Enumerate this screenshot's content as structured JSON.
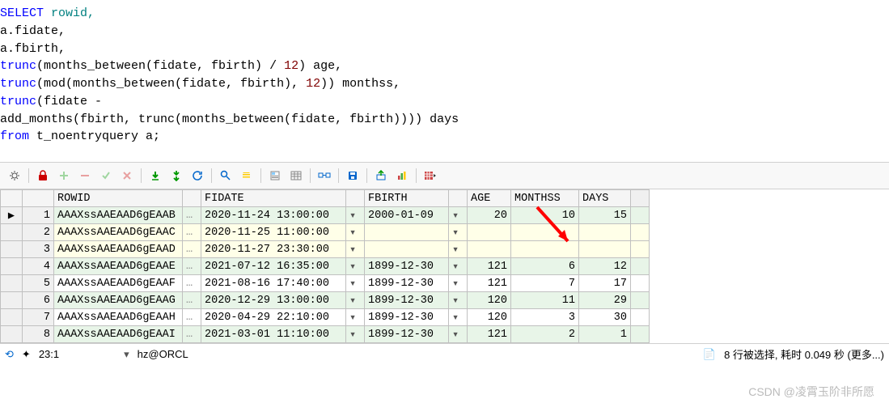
{
  "sql": {
    "line1_select": "SELECT",
    "line1_rowid": " rowid,",
    "line2": "       a.fidate,",
    "line3": "       a.fbirth,",
    "line4a": "       trunc",
    "line4b": "(months_between(fidate, fbirth) / ",
    "line4c": "12",
    "line4d": ") age,",
    "line5a": "       trunc",
    "line5b": "(mod(months_between(fidate, fbirth), ",
    "line5c": "12",
    "line5d": ")) monthss,",
    "line6a": "       trunc",
    "line6b": "(fidate -",
    "line7a": "             add_months(fbirth, trunc(months_between(fidate, fbirth)))) days",
    "line8a": "  from",
    "line8b": " t_noentryquery a;"
  },
  "columns": [
    "ROWID",
    "FIDATE",
    "FBIRTH",
    "AGE",
    "MONTHSS",
    "DAYS"
  ],
  "rows": [
    {
      "n": 1,
      "mark": "▶",
      "rowid": "AAAXssAAEAAD6gEAAB",
      "fidate": "2020-11-24 13:00:00",
      "fbirth": "2000-01-09",
      "age": "20",
      "monthss": "10",
      "days": "15",
      "cls": "green"
    },
    {
      "n": 2,
      "mark": "",
      "rowid": "AAAXssAAEAAD6gEAAC",
      "fidate": "2020-11-25 11:00:00",
      "fbirth": "",
      "age": "",
      "monthss": "",
      "days": "",
      "cls": "yellow"
    },
    {
      "n": 3,
      "mark": "",
      "rowid": "AAAXssAAEAAD6gEAAD",
      "fidate": "2020-11-27 23:30:00",
      "fbirth": "",
      "age": "",
      "monthss": "",
      "days": "",
      "cls": "yellow"
    },
    {
      "n": 4,
      "mark": "",
      "rowid": "AAAXssAAEAAD6gEAAE",
      "fidate": "2021-07-12 16:35:00",
      "fbirth": "1899-12-30",
      "age": "121",
      "monthss": "6",
      "days": "12",
      "cls": "green"
    },
    {
      "n": 5,
      "mark": "",
      "rowid": "AAAXssAAEAAD6gEAAF",
      "fidate": "2021-08-16 17:40:00",
      "fbirth": "1899-12-30",
      "age": "121",
      "monthss": "7",
      "days": "17",
      "cls": ""
    },
    {
      "n": 6,
      "mark": "",
      "rowid": "AAAXssAAEAAD6gEAAG",
      "fidate": "2020-12-29 13:00:00",
      "fbirth": "1899-12-30",
      "age": "120",
      "monthss": "11",
      "days": "29",
      "cls": "green"
    },
    {
      "n": 7,
      "mark": "",
      "rowid": "AAAXssAAEAAD6gEAAH",
      "fidate": "2020-04-29 22:10:00",
      "fbirth": "1899-12-30",
      "age": "120",
      "monthss": "3",
      "days": "30",
      "cls": ""
    },
    {
      "n": 8,
      "mark": "",
      "rowid": "AAAXssAAEAAD6gEAAI",
      "fidate": "2021-03-01 11:10:00",
      "fbirth": "1899-12-30",
      "age": "121",
      "monthss": "2",
      "days": "1",
      "cls": "green"
    }
  ],
  "status": {
    "pos": "23:1",
    "conn_icon": "▾",
    "conn": "hz@ORCL",
    "msg": "8 行被选择, 耗时 0.049 秒 (更多...)"
  },
  "watermark": "CSDN @凌霄玉阶非所愿",
  "icons": {
    "gear": "gear",
    "lock": "lock",
    "add": "add",
    "del": "del",
    "save": "save",
    "undo": "undo",
    "first": "first",
    "last": "last",
    "refresh": "refresh",
    "find": "find",
    "filter": "filter",
    "export": "export",
    "copy": "copy",
    "link": "link",
    "disk": "disk",
    "reload": "reload",
    "chart": "chart",
    "table": "table"
  }
}
